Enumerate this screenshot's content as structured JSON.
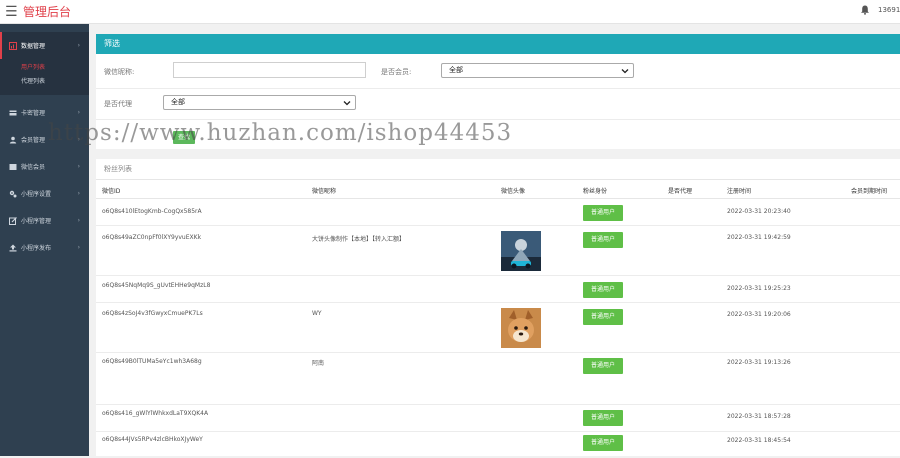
{
  "header": {
    "menu_icon": "hamburger-icon",
    "title": "管理后台",
    "bell_icon": "bell-icon",
    "user": "13691"
  },
  "sidebar": {
    "items": [
      {
        "label": "数据管理",
        "icon": "chart-icon",
        "sub": [
          "用户列表",
          "代理列表"
        ]
      },
      {
        "label": "卡密管理",
        "icon": "card-icon"
      },
      {
        "label": "会员管理",
        "icon": "user-icon"
      },
      {
        "label": "微信会员",
        "icon": "wechat-icon"
      },
      {
        "label": "小程序设置",
        "icon": "settings-icon"
      },
      {
        "label": "小程序管理",
        "icon": "edit-icon"
      },
      {
        "label": "小程序发布",
        "icon": "upload-icon"
      }
    ]
  },
  "filter": {
    "title": "筛选",
    "nickname_label": "微信昵称:",
    "nickname_value": "",
    "member_label": "是否会员:",
    "member_value": "全部",
    "agent_label": "是否代理",
    "agent_value": "全部",
    "search_button": "查找"
  },
  "list": {
    "title": "粉丝列表",
    "columns": [
      "微信ID",
      "微信昵称",
      "微信头像",
      "粉丝身份",
      "是否代理",
      "注册时间",
      "会员到期时间"
    ],
    "rows": [
      {
        "id": "o6Q8s410lEtogKmb-CogQx585rA",
        "nickname": "",
        "avatar": "",
        "identity": "普通用户",
        "agent": "",
        "reg_time": "2022-03-31 20:23:40",
        "expire": ""
      },
      {
        "id": "o6Q8s49aZC0npFf0lXY9yvuEXKk",
        "nickname": "大饼头像制作【本地】【转入汇额】",
        "avatar": "game-character-avatar",
        "identity": "普通用户",
        "agent": "",
        "reg_time": "2022-03-31 19:42:59",
        "expire": ""
      },
      {
        "id": "o6Q8s45NqMq9S_gUvtEHHe9qMzL8",
        "nickname": "",
        "avatar": "",
        "identity": "普通用户",
        "agent": "",
        "reg_time": "2022-03-31 19:25:23",
        "expire": ""
      },
      {
        "id": "o6Q8s4zSoJ4v3fGwyxCmuePK7Ls",
        "nickname": "WY",
        "avatar": "shiba-dog-avatar",
        "identity": "普通用户",
        "agent": "",
        "reg_time": "2022-03-31 19:20:06",
        "expire": ""
      },
      {
        "id": "o6Q8s49B0lTUMa5eYc1wh3A68g",
        "nickname": "阿南",
        "avatar": "",
        "identity": "普通用户",
        "agent": "",
        "reg_time": "2022-03-31 19:13:26",
        "expire": ""
      },
      {
        "id": "o6Q8s416_gWlYlWhkxdLaT9XQK4A",
        "nickname": "",
        "avatar": "",
        "identity": "普通用户",
        "agent": "",
        "reg_time": "2022-03-31 18:57:28",
        "expire": ""
      },
      {
        "id": "o6Q8s44JVs5RPv4zlcBHkoXJyWeY",
        "nickname": "",
        "avatar": "",
        "identity": "普通用户",
        "agent": "",
        "reg_time": "2022-03-31 18:45:54",
        "expire": ""
      }
    ]
  },
  "watermark": "https://www.huzhan.com/ishop44453",
  "colors": {
    "accent_red": "#e0404a",
    "filter_header": "#1fa8b6",
    "sidebar": "#2f4050",
    "tag_green": "#5fbf47"
  }
}
